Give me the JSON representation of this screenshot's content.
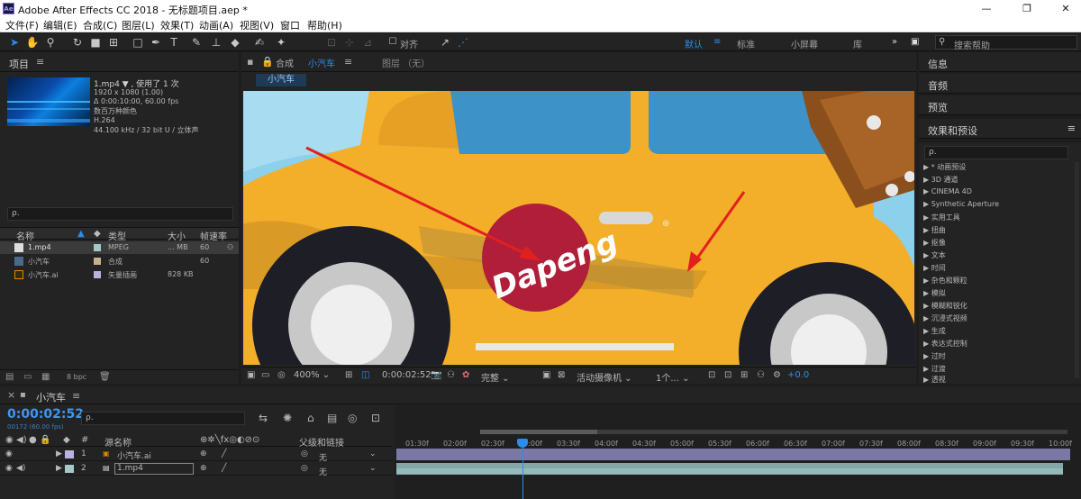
{
  "window": {
    "title": "Adobe After Effects CC 2018 - 无标题项目.aep *",
    "app_icon": "Ae",
    "minimize": "—",
    "maximize": "❐",
    "close": "✕"
  },
  "menu": [
    "文件(F)",
    "编辑(E)",
    "合成(C)",
    "图层(L)",
    "效果(T)",
    "动画(A)",
    "视图(V)",
    "窗口",
    "帮助(H)"
  ],
  "toolbar": {
    "align_label": "对齐",
    "workspaces": [
      "默认",
      "标准",
      "小屏幕",
      "库"
    ],
    "more": "»",
    "search_placeholder": "搜索帮助"
  },
  "project": {
    "title": "项目",
    "menu": "≡",
    "file_name": "1.mp4 ▼ , 使用了 1 次",
    "file_info": [
      "1920 x 1080 (1.00)",
      "Δ 0:00:10:00, 60.00 fps",
      "数百万种颜色",
      "H.264",
      "44.100 kHz / 32 bit U / 立体声"
    ],
    "search_placeholder": "ρ.",
    "columns": {
      "name": "名称",
      "type": "类型",
      "size": "大小",
      "fps": "帧速率"
    },
    "items": [
      {
        "name": "1.mp4",
        "type": "MPEG",
        "size": "... MB",
        "fps": "60",
        "color": "#a8c8c8"
      },
      {
        "name": "小汽车",
        "type": "合成",
        "size": "",
        "fps": "60",
        "color": "#c8b08a"
      },
      {
        "name": "小汽车.ai",
        "type": "矢量插画",
        "size": "828 KB",
        "fps": "",
        "color": "#b9b3e0"
      }
    ],
    "bpc": "8 bpc"
  },
  "viewer": {
    "comp_tab_label": "合成",
    "comp_tab_name": "小汽车",
    "layer_tab": "图层 （无）",
    "comp_chip": "小汽车",
    "canvas_text": "Dapeng",
    "zoom": "400%",
    "time": "0:00:02:52",
    "resolution": "完整",
    "camera": "活动摄像机",
    "views": "1个...",
    "exposure": "+0.0"
  },
  "right_panel": {
    "sections": [
      "信息",
      "音频",
      "预览",
      "效果和预设"
    ],
    "fx_menu": "≡",
    "fx_search": "ρ.",
    "fx_items": [
      "* 动画预设",
      "3D 通道",
      "CINEMA 4D",
      "Synthetic Aperture",
      "实用工具",
      "扭曲",
      "抠像",
      "文本",
      "时间",
      "杂色和颗粒",
      "模拟",
      "模糊和锐化",
      "沉浸式视频",
      "生成",
      "表达式控制",
      "过时",
      "过渡",
      "透视"
    ]
  },
  "timeline": {
    "close": "×",
    "comp_name": "小汽车",
    "menu": "≡",
    "timecode": "0:00:02:52",
    "frames": "00172 (60.00 fps)",
    "search_placeholder": "ρ.",
    "columns": {
      "hash": "#",
      "source_name": "源名称",
      "parent": "父级和链接"
    },
    "layers": [
      {
        "num": "1",
        "name": "小汽车.ai",
        "parent": "无",
        "color": "#b9b3e0"
      },
      {
        "num": "2",
        "name": "1.mp4",
        "parent": "无",
        "color": "#a8c8c8"
      }
    ],
    "ruler": [
      "01:30f",
      "02:00f",
      "02:30f",
      "03:00f",
      "03:30f",
      "04:00f",
      "04:30f",
      "05:00f",
      "05:30f",
      "06:00f",
      "06:30f",
      "07:00f",
      "07:30f",
      "08:00f",
      "08:30f",
      "09:00f",
      "09:30f",
      "10:00f"
    ]
  }
}
